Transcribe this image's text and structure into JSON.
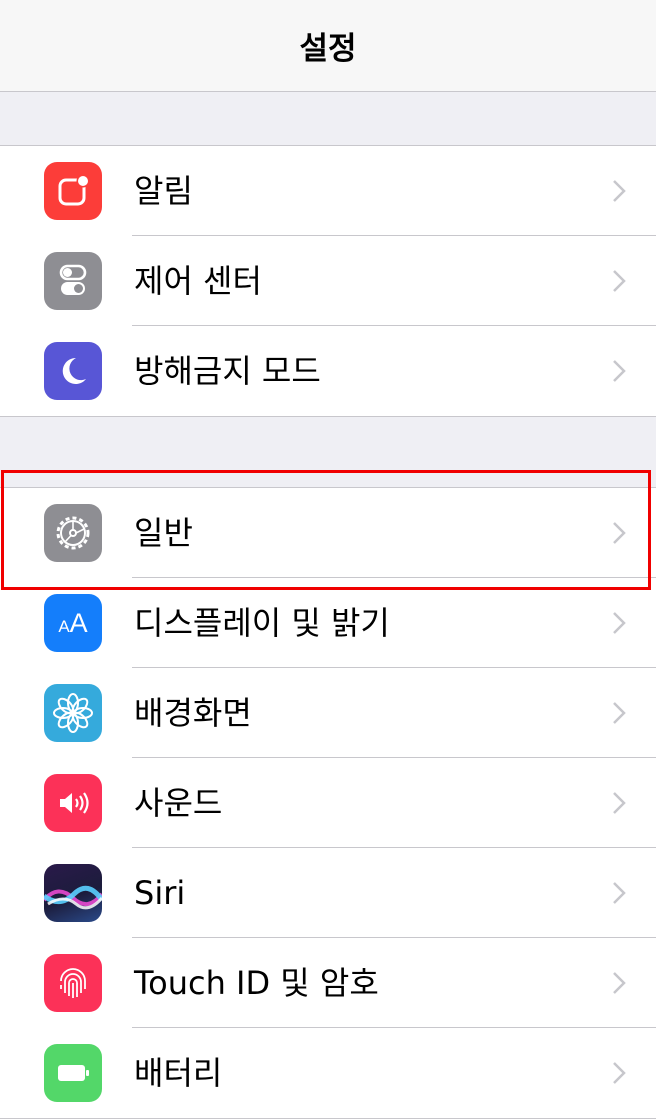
{
  "navbar": {
    "title": "설정"
  },
  "groups": [
    {
      "items": [
        {
          "label": "알림",
          "icon": "notifications-icon",
          "color": "#fc3d39"
        },
        {
          "label": "제어 센터",
          "icon": "control-center-icon",
          "color": "#8e8e93"
        },
        {
          "label": "방해금지 모드",
          "icon": "moon-icon",
          "color": "#5856d6"
        }
      ]
    },
    {
      "items": [
        {
          "label": "일반",
          "icon": "gear-icon",
          "color": "#8e8e93"
        },
        {
          "label": "디스플레이 및 밝기",
          "icon": "display-aa-icon",
          "glyph": "AA",
          "color": "#147efb"
        },
        {
          "label": "배경화면",
          "icon": "wallpaper-flower-icon",
          "color": "#35aadc"
        },
        {
          "label": "사운드",
          "icon": "speaker-icon",
          "color": "#fc3158"
        },
        {
          "label": "Siri",
          "icon": "siri-icon",
          "color": "#1c1c3c"
        },
        {
          "label": "Touch ID 및 암호",
          "icon": "fingerprint-icon",
          "color": "#fc3158"
        },
        {
          "label": "배터리",
          "icon": "battery-icon",
          "color": "#53d769"
        }
      ]
    }
  ],
  "highlight": {
    "target": "일반",
    "color": "#f00000"
  }
}
